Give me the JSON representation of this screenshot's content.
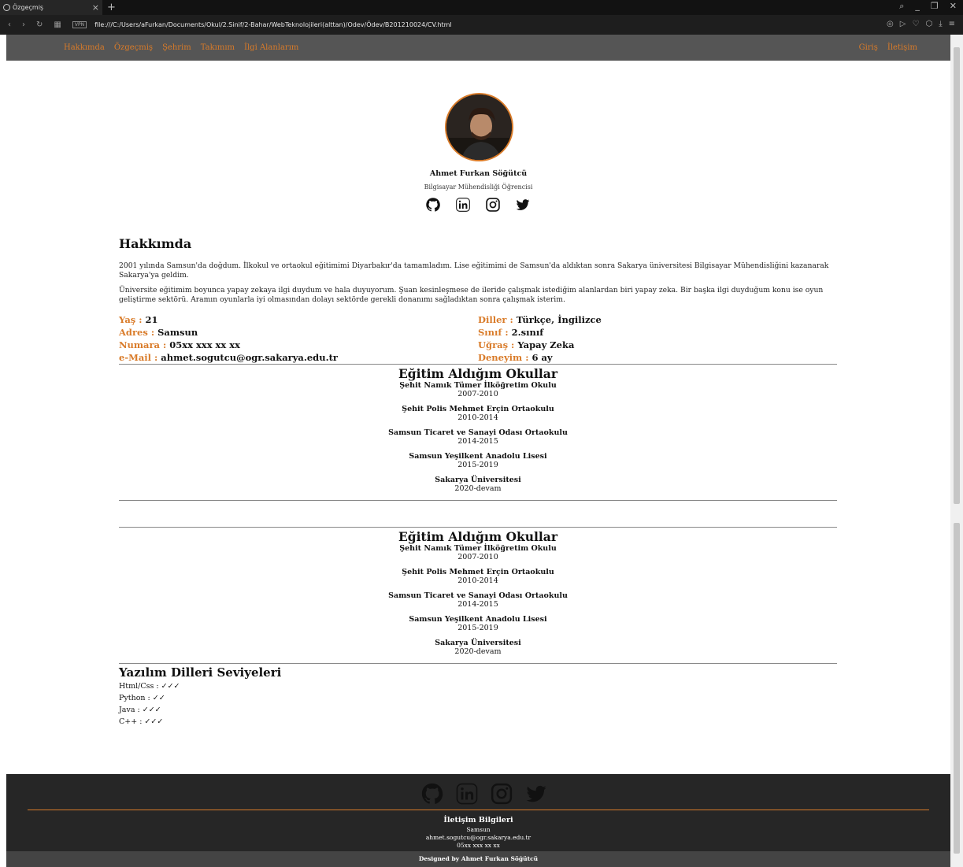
{
  "browser": {
    "tab_title": "Özgeçmiş",
    "url": "file:///C:/Users/aFurkan/Documents/Okul/2.Sinif/2-Bahar/WebTeknolojileri(alttan)/Odev/Ödev/B201210024/CV.html"
  },
  "nav": {
    "left": [
      "Hakkımda",
      "Özgeçmiş",
      "Şehrim",
      "Takımım",
      "İlgi Alanlarım"
    ],
    "right": [
      "Giriş",
      "İletişim"
    ]
  },
  "profile": {
    "name": "Ahmet Furkan Söğütcü",
    "role": "Bilgisayar Mühendisliği Öğrencisi"
  },
  "about": {
    "title": "Hakkımda",
    "p1": "2001 yılında Samsun'da doğdum. İlkokul ve ortaokul eğitimimi Diyarbakır'da tamamladım. Lise eğitimimi de Samsun'da aldıktan sonra Sakarya üniversitesi Bilgisayar Mühendisliğini kazanarak Sakarya'ya geldim.",
    "p2": "Üniversite eğitimim boyunca yapay zekaya ilgi duydum ve hala duyuyorum. Şuan kesinleşmese de ileride çalışmak istediğim alanlardan biri yapay zeka. Bir başka ilgi duyduğum konu ise oyun geliştirme sektörü. Aramın oyunlarla iyi olmasından dolayı sektörde gerekli donanımı sağladıktan sonra çalışmak isterim."
  },
  "info_left": [
    {
      "k": "Yaş : ",
      "v": "21"
    },
    {
      "k": "Adres : ",
      "v": "Samsun"
    },
    {
      "k": "Numara : ",
      "v": "05xx xxx xx xx"
    },
    {
      "k": "e-Mail : ",
      "v": "ahmet.sogutcu@ogr.sakarya.edu.tr"
    }
  ],
  "info_right": [
    {
      "k": "Diller : ",
      "v": "Türkçe, İngilizce"
    },
    {
      "k": "Sınıf : ",
      "v": "2.sınıf"
    },
    {
      "k": "Uğraş : ",
      "v": "Yapay Zeka"
    },
    {
      "k": "Deneyim : ",
      "v": "6 ay"
    }
  ],
  "education": {
    "title": "Eğitim Aldığım Okullar",
    "schools": [
      {
        "name": "Şehit Namık Tümer İlköğretim Okulu",
        "years": "2007-2010"
      },
      {
        "name": "Şehit Polis Mehmet Erçin Ortaokulu",
        "years": "2010-2014"
      },
      {
        "name": "Samsun Ticaret ve Sanayi Odası Ortaokulu",
        "years": "2014-2015"
      },
      {
        "name": "Samsun Yeşilkent Anadolu Lisesi",
        "years": "2015-2019"
      },
      {
        "name": "Sakarya Üniversitesi",
        "years": "2020-devam"
      }
    ]
  },
  "languages": {
    "title": "Yazılım Dilleri Seviyeleri",
    "items": [
      "Html/Css : ✓✓✓",
      "Python : ✓✓",
      "Java : ✓✓✓",
      "C++ : ✓✓✓"
    ]
  },
  "footer": {
    "title": "İletişim Bilgileri",
    "city": "Samsun",
    "email": "ahmet.sogutcu@ogr.sakarya.edu.tr",
    "phone": "05xx xxx xx xx",
    "copyright": "Designed by Ahmet Furkan Söğütcü"
  },
  "colors": {
    "accent": "#d97b29",
    "nav_bg": "#555555",
    "footer_bg": "#262626"
  },
  "icons": [
    "github-icon",
    "linkedin-icon",
    "instagram-icon",
    "twitter-icon"
  ]
}
